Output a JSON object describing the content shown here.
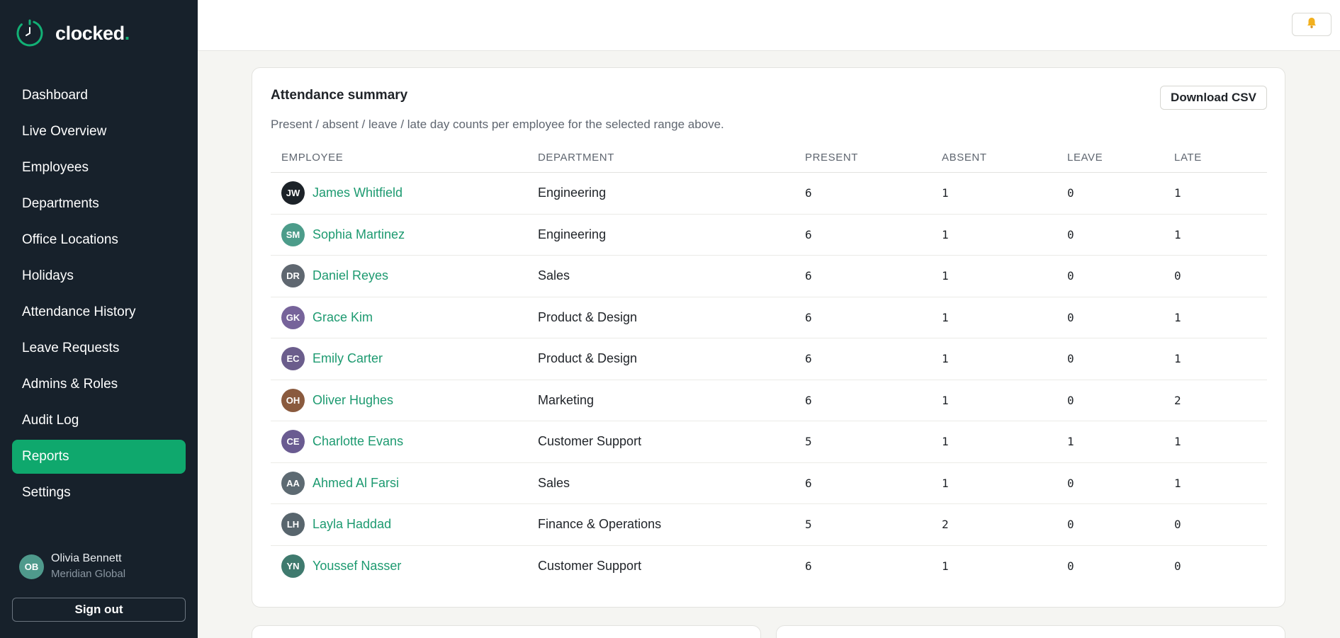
{
  "brand": {
    "name": "clocked",
    "dot": ".",
    "accent": "#12b075"
  },
  "sidebar": {
    "items": [
      {
        "label": "Dashboard",
        "active": false
      },
      {
        "label": "Live Overview",
        "active": false
      },
      {
        "label": "Employees",
        "active": false
      },
      {
        "label": "Departments",
        "active": false
      },
      {
        "label": "Office Locations",
        "active": false
      },
      {
        "label": "Holidays",
        "active": false
      },
      {
        "label": "Attendance History",
        "active": false
      },
      {
        "label": "Leave Requests",
        "active": false
      },
      {
        "label": "Admins & Roles",
        "active": false
      },
      {
        "label": "Audit Log",
        "active": false
      },
      {
        "label": "Reports",
        "active": true
      },
      {
        "label": "Settings",
        "active": false
      }
    ],
    "user": {
      "initials": "OB",
      "name": "Olivia Bennett",
      "org": "Meridian Global"
    },
    "signout_label": "Sign out"
  },
  "topbar": {
    "notifications_icon": "bell-icon"
  },
  "report": {
    "title": "Attendance summary",
    "subtitle": "Present / absent / leave / late day counts per employee for the selected range above.",
    "download_label": "Download CSV",
    "columns": [
      "EMPLOYEE",
      "DEPARTMENT",
      "PRESENT",
      "ABSENT",
      "LEAVE",
      "LATE"
    ],
    "rows": [
      {
        "initials": "JW",
        "avatar_color": "#1c2228",
        "name": "James Whitfield",
        "department": "Engineering",
        "present": "6",
        "absent": "1",
        "leave": "0",
        "late": "1"
      },
      {
        "initials": "SM",
        "avatar_color": "#4c9c8a",
        "name": "Sophia Martinez",
        "department": "Engineering",
        "present": "6",
        "absent": "1",
        "leave": "0",
        "late": "1"
      },
      {
        "initials": "DR",
        "avatar_color": "#5f6770",
        "name": "Daniel Reyes",
        "department": "Sales",
        "present": "6",
        "absent": "1",
        "leave": "0",
        "late": "0"
      },
      {
        "initials": "GK",
        "avatar_color": "#76639a",
        "name": "Grace Kim",
        "department": "Product & Design",
        "present": "6",
        "absent": "1",
        "leave": "0",
        "late": "1"
      },
      {
        "initials": "EC",
        "avatar_color": "#6b5d8c",
        "name": "Emily Carter",
        "department": "Product & Design",
        "present": "6",
        "absent": "1",
        "leave": "0",
        "late": "1"
      },
      {
        "initials": "OH",
        "avatar_color": "#8a5a3e",
        "name": "Oliver Hughes",
        "department": "Marketing",
        "present": "6",
        "absent": "1",
        "leave": "0",
        "late": "2"
      },
      {
        "initials": "CE",
        "avatar_color": "#6a5b91",
        "name": "Charlotte Evans",
        "department": "Customer Support",
        "present": "5",
        "absent": "1",
        "leave": "1",
        "late": "1"
      },
      {
        "initials": "AA",
        "avatar_color": "#5d6a72",
        "name": "Ahmed Al Farsi",
        "department": "Sales",
        "present": "6",
        "absent": "1",
        "leave": "0",
        "late": "1"
      },
      {
        "initials": "LH",
        "avatar_color": "#58656d",
        "name": "Layla Haddad",
        "department": "Finance & Operations",
        "present": "5",
        "absent": "2",
        "leave": "0",
        "late": "0"
      },
      {
        "initials": "YN",
        "avatar_color": "#3f7a6e",
        "name": "Youssef Nasser",
        "department": "Customer Support",
        "present": "6",
        "absent": "1",
        "leave": "0",
        "late": "0"
      }
    ]
  }
}
